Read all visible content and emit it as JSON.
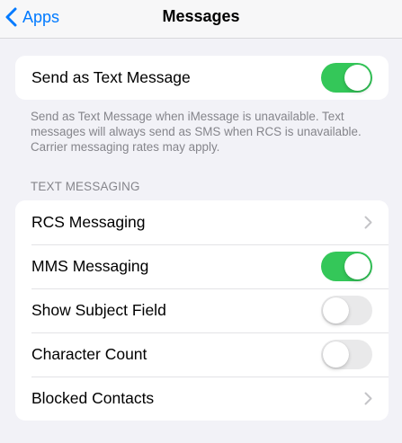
{
  "navbar": {
    "back_label": "Apps",
    "title": "Messages"
  },
  "send_as_text": {
    "label": "Send as Text Message",
    "enabled": true,
    "footer": "Send as Text Message when iMessage is unavailable. Text messages will always send as SMS when RCS is unavailable. Carrier messaging rates may apply."
  },
  "text_messaging": {
    "header": "TEXT MESSAGING",
    "rows": [
      {
        "label": "RCS Messaging",
        "control": "chevron-right-icon"
      },
      {
        "label": "MMS Messaging",
        "control": "toggle",
        "enabled": true
      },
      {
        "label": "Show Subject Field",
        "control": "toggle",
        "enabled": false
      },
      {
        "label": "Character Count",
        "control": "toggle",
        "enabled": false
      },
      {
        "label": "Blocked Contacts",
        "control": "chevron-right-icon"
      }
    ]
  },
  "colors": {
    "accent": "#007aff",
    "toggle_on": "#34c759",
    "toggle_off": "#e9e9ea",
    "background": "#f2f2f7",
    "secondary_text": "#85858b"
  }
}
